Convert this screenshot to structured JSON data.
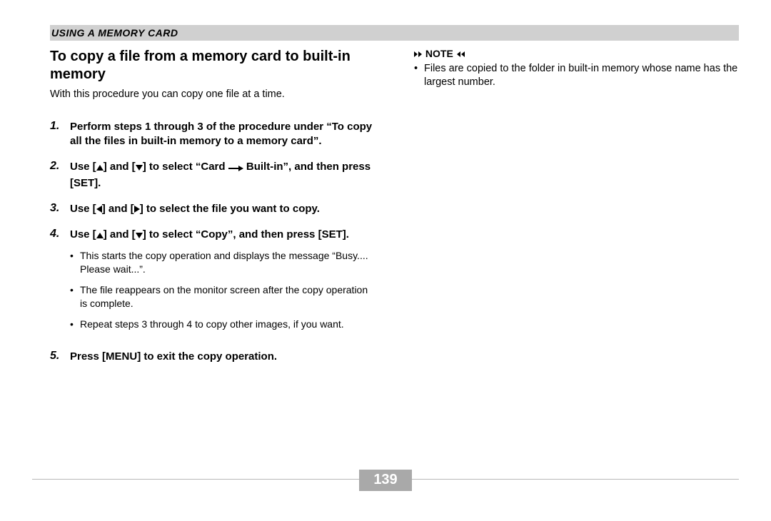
{
  "header": "USING A MEMORY CARD",
  "title": "To copy a file from a memory card to built-in memory",
  "intro": "With this procedure you can copy one file at a time.",
  "steps": [
    {
      "num": "1.",
      "parts": [
        {
          "t": "text",
          "v": "Perform steps 1 through 3 of the procedure under “To copy all the files in built-in memory to a memory card”."
        }
      ]
    },
    {
      "num": "2.",
      "parts": [
        {
          "t": "text",
          "v": "Use ["
        },
        {
          "t": "tri-up"
        },
        {
          "t": "text",
          "v": "] and ["
        },
        {
          "t": "tri-down"
        },
        {
          "t": "text",
          "v": "] to select “Card "
        },
        {
          "t": "arrow-right"
        },
        {
          "t": "text",
          "v": " Built-in”, and then press [SET]."
        }
      ]
    },
    {
      "num": "3.",
      "parts": [
        {
          "t": "text",
          "v": "Use ["
        },
        {
          "t": "tri-left"
        },
        {
          "t": "text",
          "v": "] and ["
        },
        {
          "t": "tri-right"
        },
        {
          "t": "text",
          "v": "] to select the file you want to copy."
        }
      ]
    },
    {
      "num": "4.",
      "parts": [
        {
          "t": "text",
          "v": "Use ["
        },
        {
          "t": "tri-up"
        },
        {
          "t": "text",
          "v": "] and ["
        },
        {
          "t": "tri-down"
        },
        {
          "t": "text",
          "v": "] to select “Copy”, and then press [SET]."
        }
      ],
      "subs": [
        "This starts the copy operation and displays the message “Busy.... Please wait...”.",
        "The file reappears on the monitor screen after the copy operation is complete.",
        "Repeat steps 3 through 4 to copy other images, if you want."
      ]
    },
    {
      "num": "5.",
      "parts": [
        {
          "t": "text",
          "v": "Press [MENU] to exit the copy operation."
        }
      ]
    }
  ],
  "note": {
    "label": "NOTE",
    "items": [
      "Files are copied to the folder in built-in memory whose name has the largest number."
    ]
  },
  "page_number": "139"
}
